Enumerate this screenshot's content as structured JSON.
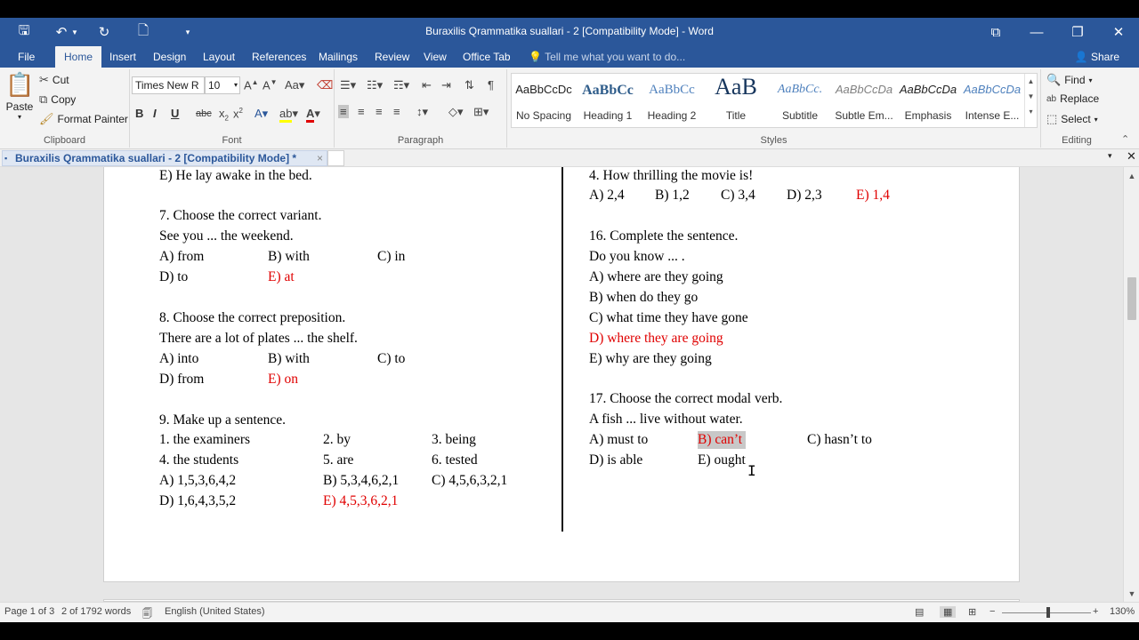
{
  "window": {
    "title": "Buraxilis Qrammatika suallari - 2 [Compatibility Mode] - Word"
  },
  "tabs": {
    "file": "File",
    "home": "Home",
    "insert": "Insert",
    "design": "Design",
    "layout": "Layout",
    "references": "References",
    "mailings": "Mailings",
    "review": "Review",
    "view": "View",
    "office_tab": "Office Tab",
    "tell_me": "Tell me what you want to do...",
    "share": "Share"
  },
  "ribbon": {
    "clipboard": {
      "paste": "Paste",
      "cut": "Cut",
      "copy": "Copy",
      "format_painter": "Format Painter",
      "label": "Clipboard"
    },
    "font": {
      "name": "Times New R",
      "size": "10",
      "label": "Font"
    },
    "paragraph": {
      "label": "Paragraph"
    },
    "styles": {
      "label": "Styles",
      "items": [
        {
          "sample": "AaBbCcDc",
          "name": "No Spacing"
        },
        {
          "sample": "AaBbCc",
          "name": "Heading 1"
        },
        {
          "sample": "AaBbCc",
          "name": "Heading 2"
        },
        {
          "sample": "AaB",
          "name": "Title"
        },
        {
          "sample": "AaBbCc.",
          "name": "Subtitle"
        },
        {
          "sample": "AaBbCcDa",
          "name": "Subtle Em..."
        },
        {
          "sample": "AaBbCcDa",
          "name": "Emphasis"
        },
        {
          "sample": "AaBbCcDa",
          "name": "Intense E..."
        }
      ]
    },
    "editing": {
      "find": "Find",
      "replace": "Replace",
      "select": "Select",
      "label": "Editing"
    }
  },
  "doc_tab": {
    "name": "Buraxilis Qrammatika suallari - 2 [Compatibility Mode] *",
    "close": "×"
  },
  "document": {
    "left": {
      "q6_last": "E) He lay awake in the bed.",
      "q7_title": "7. Choose the correct variant.",
      "q7_text": "See you ... the weekend.",
      "q7_a": "A) from",
      "q7_b": "B) with",
      "q7_c": "C) in",
      "q7_d": "D) to",
      "q7_e": "E) at",
      "q8_title": "8. Choose the correct preposition.",
      "q8_text": "There are a lot of plates ... the shelf.",
      "q8_a": "A) into",
      "q8_b": "B) with",
      "q8_c": "C) to",
      "q8_d": "D) from",
      "q8_e": "E) on",
      "q9_title": "9. Make up a sentence.",
      "q9_w1": "1. the examiners",
      "q9_w2": "2. by",
      "q9_w3": "3. being",
      "q9_w4": "4. the students",
      "q9_w5": "5. are",
      "q9_w6": "6. tested",
      "q9_a": "A) 1,5,3,6,4,2",
      "q9_b": "B) 5,3,4,6,2,1",
      "q9_c": "C) 4,5,6,3,2,1",
      "q9_d": "D) 1,6,4,3,5,2",
      "q9_e": "E) 4,5,3,6,2,1"
    },
    "right": {
      "q15_item4": "4. How thrilling the movie is!",
      "q15_a": "A) 2,4",
      "q15_b": "B) 1,2",
      "q15_c": "C) 3,4",
      "q15_d": "D) 2,3",
      "q15_e": "E) 1,4",
      "q16_title": "16. Complete the sentence.",
      "q16_text": "Do you know ... .",
      "q16_a": "A) where are they going",
      "q16_b": "B) when do they go",
      "q16_c": "C) what time they have gone",
      "q16_d": "D) where they are going",
      "q16_e": "E) why are they going",
      "q17_title": "17. Choose the correct modal verb.",
      "q17_text": "A fish ... live without water.",
      "q17_a": "A) must to",
      "q17_b": "B) can’t",
      "q17_c": "C) hasn’t to",
      "q17_d": "D) is able",
      "q17_e": "E) ought"
    }
  },
  "status": {
    "page": "Page 1 of 3",
    "words": "2 of 1792 words",
    "language": "English (United States)",
    "zoom": "130%"
  },
  "colors": {
    "brand": "#2b579a",
    "answer": "#e00000"
  }
}
